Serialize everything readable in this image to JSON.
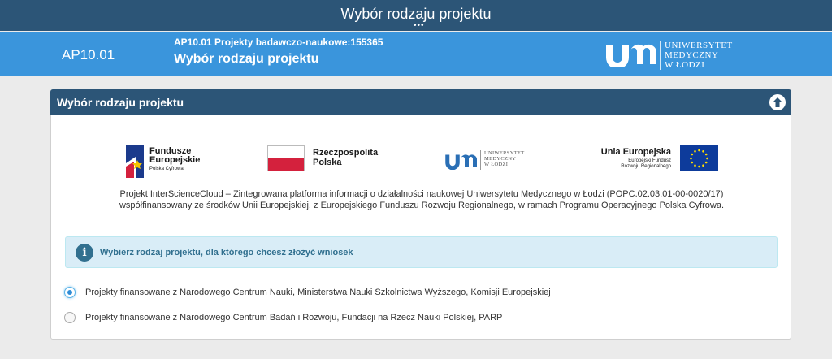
{
  "topbar": {
    "title": "Wybór rodzaju projektu",
    "dots": "•••"
  },
  "header": {
    "code": "AP10.01",
    "subtitle": "AP10.01 Projekty badawczo-naukowe:155365",
    "title": "Wybór rodzaju projektu",
    "logo_lines": [
      "UNIWERSYTET",
      "MEDYCZNY",
      "W ŁODZI"
    ]
  },
  "panel": {
    "title": "Wybór rodzaju projektu",
    "logos": {
      "fe_line1": "Fundusze",
      "fe_line2": "Europejskie",
      "fe_line3": "Polska Cyfrowa",
      "rp_line1": "Rzeczpospolita",
      "rp_line2": "Polska",
      "um_lines": [
        "UNIWERSYTET",
        "MEDYCZNY",
        "W ŁODZI"
      ],
      "ue_line1": "Unia Europejska",
      "ue_line2": "Europejski Fundusz",
      "ue_line3": "Rozwoju Regionalnego"
    },
    "description_line1": "Projekt InterScienceCloud – Zintegrowana platforma informacji o działalności naukowej Uniwersytetu Medycznego w Łodzi (POPC.02.03.01-00-0020/17)",
    "description_line2": "współfinansowany ze środków Unii Europejskiej, z Europejskiego Funduszu Rozwoju Regionalnego, w ramach Programu Operacyjnego Polska Cyfrowa.",
    "info_icon": "i",
    "info_message": "Wybierz rodzaj projektu, dla którego chcesz złożyć wniosek",
    "options": [
      {
        "label": "Projekty finansowane z Narodowego Centrum Nauki, Ministerstwa Nauki Szkolnictwa Wyższego, Komisji Europejskiej",
        "selected": true
      },
      {
        "label": "Projekty finansowane z Narodowego Centrum Badań i Rozwoju, Fundacji na Rzecz Nauki Polskiej, PARP",
        "selected": false
      }
    ]
  },
  "colors": {
    "topbar": "#2c5577",
    "header": "#3a95dc",
    "panel_header": "#2c5577",
    "info_bg": "#d9edf7",
    "info_text": "#31708f",
    "radio_selected": "#2f8dd6"
  },
  "icons": [
    "um-logo-icon",
    "collapse-up-icon",
    "info-icon",
    "eu-stars-icon",
    "fundusze-europejskie-icon",
    "polish-flag-icon"
  ]
}
